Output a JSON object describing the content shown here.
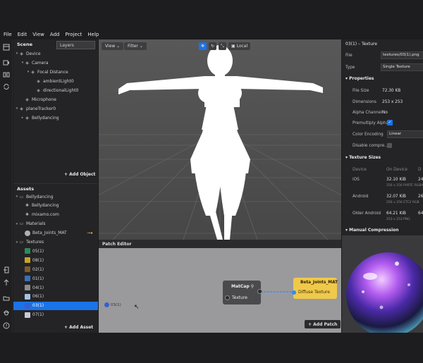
{
  "menu": [
    "File",
    "Edit",
    "View",
    "Add",
    "Project",
    "Help"
  ],
  "layer_tooltip": "Layers",
  "scene": {
    "title": "Scene",
    "items": [
      {
        "label": "Device",
        "indent": 0,
        "icon": "device-icon",
        "expanded": true
      },
      {
        "label": "Camera",
        "indent": 1,
        "icon": "camera-icon",
        "expanded": true
      },
      {
        "label": "Focal Distance",
        "indent": 2,
        "icon": "focal-distance-icon",
        "expanded": true
      },
      {
        "label": "ambientLight0",
        "indent": 3,
        "icon": "ambient-light-icon",
        "expanded": null
      },
      {
        "label": "directionalLight0",
        "indent": 3,
        "icon": "directional-light-icon",
        "expanded": null
      },
      {
        "label": "Microphone",
        "indent": 1,
        "icon": "microphone-icon",
        "expanded": null
      },
      {
        "label": "planeTracker0",
        "indent": 0,
        "icon": "plane-tracker-icon",
        "expanded": true
      },
      {
        "label": "Bellydancing",
        "indent": 1,
        "icon": "object-icon",
        "expanded": false
      }
    ],
    "add_label": "Add Object"
  },
  "assets": {
    "title": "Assets",
    "items": [
      {
        "label": "Bellydancing",
        "indent": 0,
        "kind": "folder",
        "expanded": true,
        "color": ""
      },
      {
        "label": "Bellydancing",
        "indent": 1,
        "kind": "object",
        "expanded": null,
        "color": ""
      },
      {
        "label": "mixamo.com",
        "indent": 1,
        "kind": "object",
        "expanded": null,
        "color": ""
      },
      {
        "label": "Materials",
        "indent": 0,
        "kind": "folder",
        "expanded": true,
        "color": ""
      },
      {
        "label": "Beta_Joints_MAT",
        "indent": 1,
        "kind": "material",
        "expanded": null,
        "color": "#b0b0b0"
      },
      {
        "label": "Textures",
        "indent": 0,
        "kind": "folder",
        "expanded": true,
        "color": ""
      },
      {
        "label": "05(1)",
        "indent": 1,
        "kind": "texture",
        "expanded": null,
        "color": "#2e8b57"
      },
      {
        "label": "08(1)",
        "indent": 1,
        "kind": "texture",
        "expanded": null,
        "color": "#c9a227"
      },
      {
        "label": "02(1)",
        "indent": 1,
        "kind": "texture",
        "expanded": null,
        "color": "#7a5c2e"
      },
      {
        "label": "01(1)",
        "indent": 1,
        "kind": "texture",
        "expanded": null,
        "color": "#3b6fb5"
      },
      {
        "label": "04(1)",
        "indent": 1,
        "kind": "texture",
        "expanded": null,
        "color": "#8c8c8c"
      },
      {
        "label": "06(1)",
        "indent": 1,
        "kind": "texture",
        "expanded": null,
        "color": "#a0c4e8"
      },
      {
        "label": "03(1)",
        "indent": 1,
        "kind": "texture",
        "expanded": null,
        "color": "#3a5fcd"
      },
      {
        "label": "07(1)",
        "indent": 1,
        "kind": "texture",
        "expanded": null,
        "color": "#c8c8d8"
      }
    ],
    "selected_index": 12,
    "add_label": "Add Asset"
  },
  "viewport": {
    "view_label": "View",
    "filter_label": "Filter",
    "local_label": "Local"
  },
  "patch_editor": {
    "title": "Patch Editor",
    "matcap_title": "MatCap",
    "matcap_port": "Texture",
    "material_title": "Beta_Joints_MAT",
    "material_port": "Diffuse Texture",
    "texture_node": "03(1)",
    "add_label": "Add Patch"
  },
  "inspector": {
    "header": "03(1) – Texture",
    "file_label": "File",
    "file_value": "textures/03(1).png",
    "type_label": "Type",
    "type_value": "Single Texture",
    "properties_title": "Properties",
    "props": [
      {
        "label": "File Size",
        "value": "72.30 KB"
      },
      {
        "label": "Dimensions",
        "value": "253 x 253"
      },
      {
        "label": "Alpha Channel",
        "value": "No"
      }
    ],
    "premult_label": "Premultiply Alpha",
    "color_enc_label": "Color Encoding",
    "color_enc_value": "Linear",
    "disable_label": "Disable compre...",
    "texture_sizes_title": "Texture Sizes",
    "col_device": "Device",
    "col_on_device": "On Device",
    "col_d": "D",
    "sizes": [
      {
        "device": "iOS",
        "size": "32.10 KiB",
        "detail": "256 x 256 PVRTC RGBA",
        "right": "24"
      },
      {
        "device": "Android",
        "size": "32.07 KiB",
        "detail": "256 x 256 ETC2 RGB",
        "right": "26"
      },
      {
        "device": "Older Android",
        "size": "64.21 KiB",
        "detail": "253 x 253 PNG",
        "right": "64"
      }
    ],
    "manual_title": "Manual Compression"
  }
}
